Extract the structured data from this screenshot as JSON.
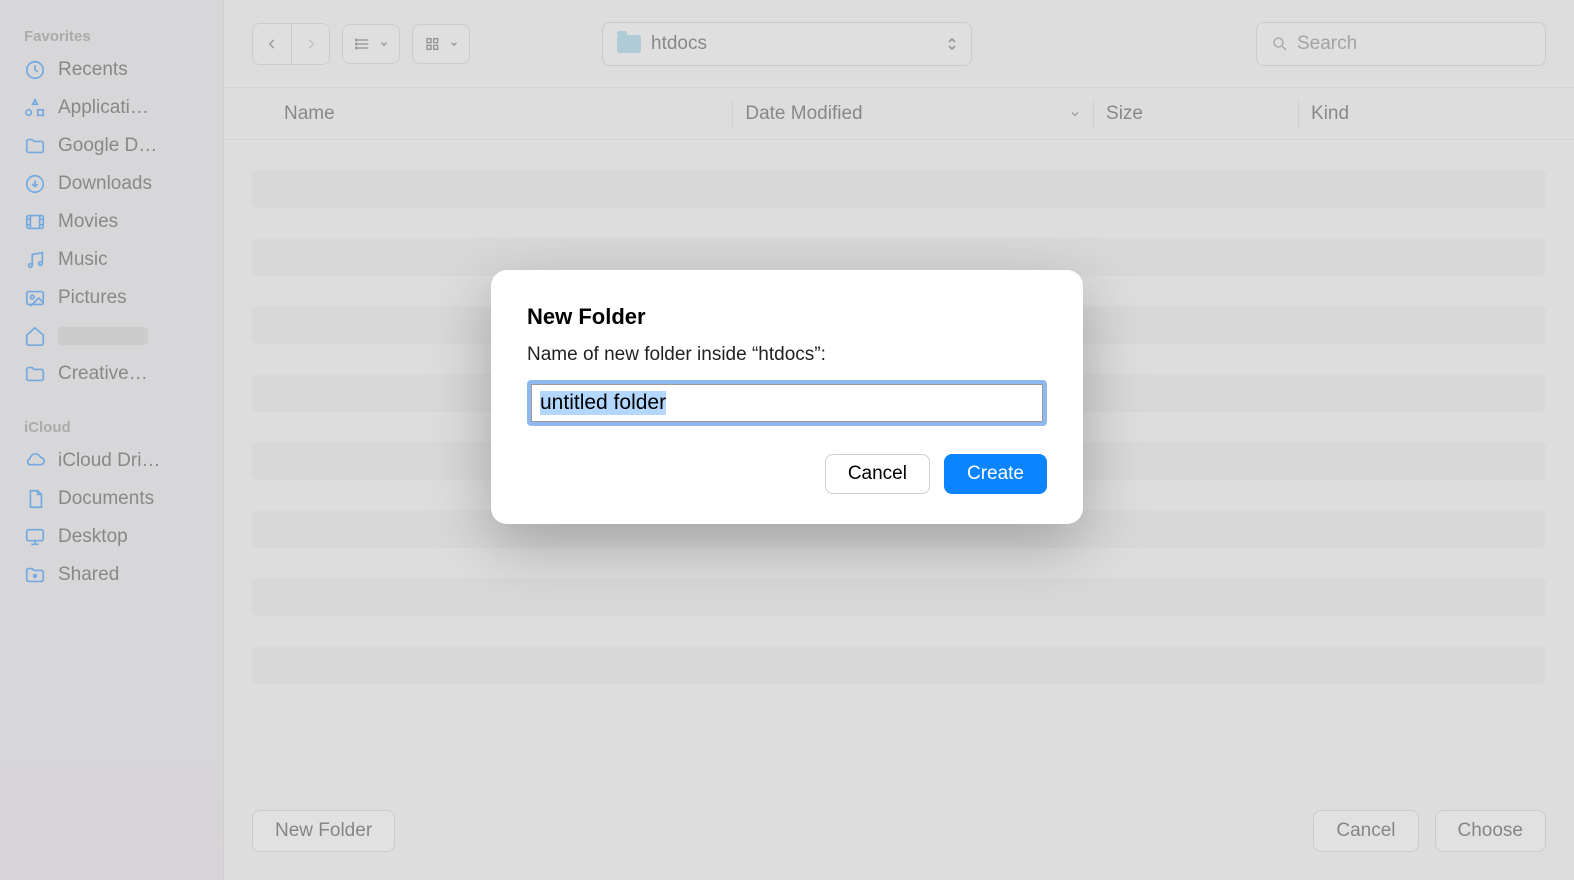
{
  "sidebar": {
    "sections": [
      {
        "title": "Favorites",
        "items": [
          {
            "label": "Recents",
            "icon": "clock-icon"
          },
          {
            "label": "Applicati…",
            "icon": "apps-icon"
          },
          {
            "label": "Google D…",
            "icon": "folder-icon"
          },
          {
            "label": "Downloads",
            "icon": "download-icon"
          },
          {
            "label": "Movies",
            "icon": "movies-icon"
          },
          {
            "label": "Music",
            "icon": "music-icon"
          },
          {
            "label": "Pictures",
            "icon": "pictures-icon"
          },
          {
            "label": "",
            "icon": "home-icon",
            "redacted": true
          },
          {
            "label": "Creative…",
            "icon": "folder-icon"
          }
        ]
      },
      {
        "title": "iCloud",
        "items": [
          {
            "label": "iCloud Dri…",
            "icon": "cloud-icon"
          },
          {
            "label": "Documents",
            "icon": "document-icon"
          },
          {
            "label": "Desktop",
            "icon": "desktop-icon"
          },
          {
            "label": "Shared",
            "icon": "shared-folder-icon"
          }
        ]
      }
    ]
  },
  "toolbar": {
    "path_label": "htdocs",
    "search_placeholder": "Search"
  },
  "columns": {
    "name": "Name",
    "date": "Date Modified",
    "size": "Size",
    "kind": "Kind"
  },
  "footer": {
    "new_folder": "New Folder",
    "cancel": "Cancel",
    "choose": "Choose"
  },
  "modal": {
    "title": "New Folder",
    "subtitle": "Name of new folder inside “htdocs”:",
    "input_value": "untitled folder",
    "cancel": "Cancel",
    "create": "Create"
  }
}
